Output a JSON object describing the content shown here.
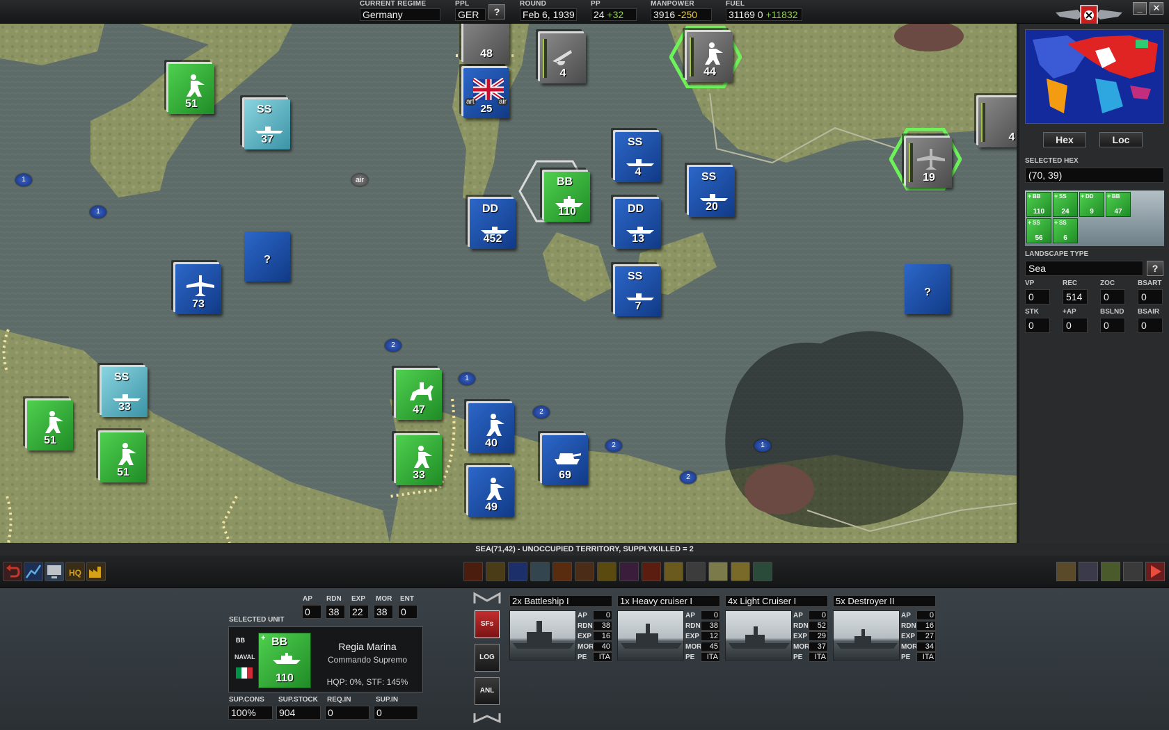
{
  "topbar": {
    "regime": {
      "label": "CURRENT REGIME",
      "value": "Germany"
    },
    "ppl": {
      "label": "PPL",
      "value": "GER",
      "help": "?"
    },
    "round": {
      "label": "ROUND",
      "value": "Feb 6, 1939"
    },
    "pp": {
      "label": "PP",
      "value": "24",
      "delta": "+32"
    },
    "manpower": {
      "label": "MANPOWER",
      "value": "3916",
      "delta": "-250"
    },
    "fuel": {
      "label": "FUEL",
      "value": "31169 0",
      "delta": "+11832"
    },
    "minimize": "_",
    "close": "✕"
  },
  "map_units": [
    {
      "id": "u1",
      "abbr": "",
      "value": "48",
      "color": "gray",
      "glyph": "infantry-icon"
    },
    {
      "id": "u2",
      "abbr": "",
      "value": "4",
      "color": "gray",
      "glyph": "artillery-icon"
    },
    {
      "id": "u3",
      "abbr": "",
      "value": "44",
      "color": "gray",
      "glyph": "infantry-icon"
    },
    {
      "id": "u4",
      "abbr": "",
      "value": "51",
      "color": "green",
      "glyph": "infantry-icon"
    },
    {
      "id": "u5",
      "abbr": "SS",
      "value": "37",
      "color": "teal",
      "glyph": "submarine-icon"
    },
    {
      "id": "u6",
      "abbr": "",
      "value": "25",
      "color": "blue",
      "glyph": "uk-flag-icon",
      "tag_left": "art",
      "tag_right": "air"
    },
    {
      "id": "u7",
      "abbr": "",
      "value": "4",
      "color": "gray",
      "glyph": "artillery-icon"
    },
    {
      "id": "u8",
      "abbr": "",
      "value": "19",
      "color": "gray",
      "glyph": "plane-icon"
    },
    {
      "id": "u9",
      "abbr": "SS",
      "value": "4",
      "color": "blue",
      "glyph": "submarine-icon"
    },
    {
      "id": "u10",
      "abbr": "BB",
      "value": "110",
      "color": "green",
      "glyph": "battleship-icon"
    },
    {
      "id": "u11",
      "abbr": "SS",
      "value": "20",
      "color": "blue",
      "glyph": "submarine-icon"
    },
    {
      "id": "u12",
      "abbr": "DD",
      "value": "452",
      "color": "blue",
      "glyph": "destroyer-icon"
    },
    {
      "id": "u13",
      "abbr": "DD",
      "value": "13",
      "color": "blue",
      "glyph": "destroyer-icon"
    },
    {
      "id": "u14",
      "abbr": "",
      "value": "?",
      "color": "blue",
      "glyph": ""
    },
    {
      "id": "u15",
      "abbr": "",
      "value": "73",
      "color": "blue",
      "glyph": "plane-icon"
    },
    {
      "id": "u16",
      "abbr": "SS",
      "value": "7",
      "color": "blue",
      "glyph": "submarine-icon"
    },
    {
      "id": "u17",
      "abbr": "",
      "value": "?",
      "color": "blue",
      "glyph": ""
    },
    {
      "id": "u18",
      "abbr": "SS",
      "value": "33",
      "color": "teal",
      "glyph": "submarine-icon"
    },
    {
      "id": "u19",
      "abbr": "",
      "value": "47",
      "color": "green",
      "glyph": "cavalry-icon"
    },
    {
      "id": "u20",
      "abbr": "",
      "value": "51",
      "color": "green",
      "glyph": "infantry-icon"
    },
    {
      "id": "u21",
      "abbr": "",
      "value": "40",
      "color": "blue",
      "glyph": "infantry-icon"
    },
    {
      "id": "u22",
      "abbr": "",
      "value": "69",
      "color": "blue",
      "glyph": "tank-icon"
    },
    {
      "id": "u23",
      "abbr": "",
      "value": "51",
      "color": "green",
      "glyph": "infantry-icon"
    },
    {
      "id": "u24",
      "abbr": "",
      "value": "33",
      "color": "green",
      "glyph": "infantry-icon"
    },
    {
      "id": "u25",
      "abbr": "",
      "value": "49",
      "color": "blue",
      "glyph": "infantry-icon"
    }
  ],
  "map_markers": {
    "m1": "1",
    "m2": "1",
    "m3": "air",
    "m4": "2",
    "m5": "1",
    "m6": "2",
    "m7": "2",
    "m8": "1",
    "m9": "2"
  },
  "right_panel": {
    "hex_button": "Hex",
    "loc_button": "Loc",
    "selected_hex_label": "SELECTED HEX",
    "selected_hex": "(70, 39)",
    "hex_units": [
      {
        "abbr": "BB",
        "value": "110"
      },
      {
        "abbr": "SS",
        "value": "24"
      },
      {
        "abbr": "DD",
        "value": "9"
      },
      {
        "abbr": "BB",
        "value": "47"
      },
      {
        "abbr": "SS",
        "value": "56"
      },
      {
        "abbr": "SS",
        "value": "6"
      }
    ],
    "landscape_label": "LANDSCAPE TYPE",
    "landscape": "Sea",
    "landscape_help": "?",
    "stats_row1": [
      {
        "label": "VP",
        "value": "0"
      },
      {
        "label": "REC",
        "value": "514"
      },
      {
        "label": "ZOC",
        "value": "0"
      },
      {
        "label": "BSART",
        "value": "0"
      }
    ],
    "stats_row2": [
      {
        "label": "STK",
        "value": "0"
      },
      {
        "label": "+AP",
        "value": "0"
      },
      {
        "label": "BSLND",
        "value": "0"
      },
      {
        "label": "BSAIR",
        "value": "0"
      }
    ]
  },
  "status_line": "SEA(71,42) - UNOCCUPIED TERRITORY, SUPPLYKILLED = 2",
  "selected_unit": {
    "label": "SELECTED UNIT",
    "stats": [
      {
        "label": "AP",
        "value": "0"
      },
      {
        "label": "RDN",
        "value": "38"
      },
      {
        "label": "EXP",
        "value": "22"
      },
      {
        "label": "MOR",
        "value": "38"
      },
      {
        "label": "ENT",
        "value": "0"
      }
    ],
    "type_abbr": "BB",
    "category": "NAVAL",
    "strength": "110",
    "name": "Regia Marina",
    "hq": "Commando Supremo",
    "hqp": "HQP: 0%, STF: 145%",
    "supply": [
      {
        "label": "SUP.CONS",
        "value": "100%"
      },
      {
        "label": "SUP.STOCK",
        "value": "904"
      },
      {
        "label": "REQ.IN",
        "value": "0"
      },
      {
        "label": "SUP.IN",
        "value": "0"
      }
    ]
  },
  "side_buttons": [
    "SFs",
    "LOG",
    "ANL"
  ],
  "ships": [
    {
      "title": "2x Battleship I",
      "AP": "0",
      "RDN": "38",
      "EXP": "16",
      "MOR": "40",
      "PE": "ITA"
    },
    {
      "title": "1x Heavy cruiser I",
      "AP": "0",
      "RDN": "38",
      "EXP": "12",
      "MOR": "45",
      "PE": "ITA"
    },
    {
      "title": "4x Light Cruiser I",
      "AP": "0",
      "RDN": "52",
      "EXP": "29",
      "MOR": "37",
      "PE": "ITA"
    },
    {
      "title": "5x Destroyer II",
      "AP": "0",
      "RDN": "16",
      "EXP": "27",
      "MOR": "34",
      "PE": "ITA"
    }
  ],
  "colors": {
    "friendly": "#2fae36",
    "enemy": "#1f4fa8",
    "neutral_sub": "#6fc0cc",
    "inactive": "#6a6a6a",
    "selection": "#6df25a"
  }
}
